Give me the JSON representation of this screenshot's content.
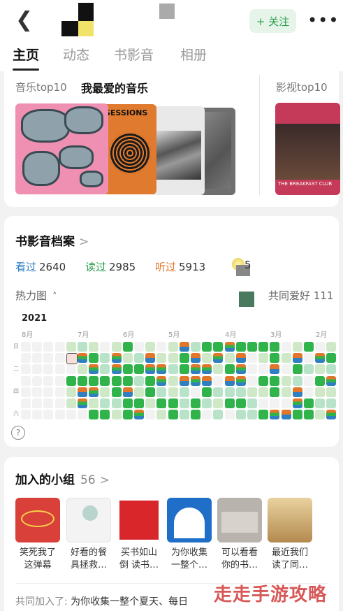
{
  "header": {
    "back_icon": "chevron-left-icon",
    "follow_label": "+ 关注",
    "more_icon": "more-icon",
    "colors": {
      "follow_bg": "#e6f4ea",
      "follow_text": "#2e9e4f"
    }
  },
  "tabs": [
    {
      "label": "主页",
      "active": true
    },
    {
      "label": "动态",
      "active": false
    },
    {
      "label": "书影音",
      "active": false
    },
    {
      "label": "相册",
      "active": false
    }
  ],
  "music": {
    "sub_label": "音乐top10",
    "main_label": "我最爱的音乐",
    "film_label": "影视top10",
    "album2_text": "SESSIONS",
    "album5_text": "THE BREAKFAST CLUB"
  },
  "archive": {
    "title": "书影音档案",
    "chevron": ">",
    "stats": [
      {
        "label": "看过",
        "value": "2640",
        "color": "#2f7fc1"
      },
      {
        "label": "读过",
        "value": "2985",
        "color": "#2e9e4f"
      },
      {
        "label": "听过",
        "value": "5913",
        "color": "#e0772b"
      }
    ],
    "badge_value": "5",
    "heatmap_label": "热力图",
    "common_label": "共同爱好",
    "common_count": "111",
    "year": "2021",
    "months": [
      "8月",
      "7月",
      "6月",
      "5月",
      "4月",
      "3月",
      "2月"
    ],
    "day_labels": [
      "日",
      "二",
      "四",
      "六"
    ],
    "help_icon": "?"
  },
  "groups": {
    "title": "加入的小组",
    "count": "56",
    "chevron": ">",
    "items": [
      {
        "name": "笑死我了\n这弹幕",
        "bg": "#d9403a"
      },
      {
        "name": "好看的餐\n具拯救…",
        "bg": "#f3f3f3"
      },
      {
        "name": "买书如山\n倒 读书…",
        "bg": "#d8262a"
      },
      {
        "name": "为你收集\n一整个…",
        "bg": "#1f6fc9"
      },
      {
        "name": "可以看看\n你的书…",
        "bg": "#b9b3ad"
      },
      {
        "name": "最近我们\n读了同…",
        "bg": "#d6b276"
      }
    ],
    "shared_prefix": "共同加入了:",
    "shared_text": "为你收集一整个夏天、每日"
  },
  "watermark": "走走手游攻略"
}
